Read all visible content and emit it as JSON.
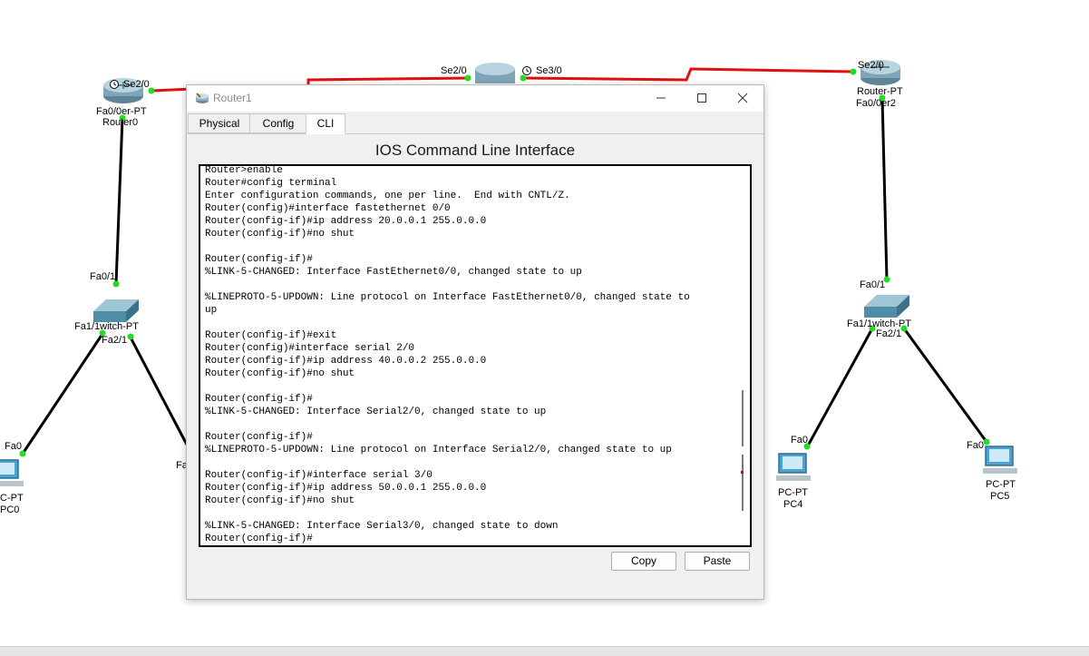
{
  "topology": {
    "links": [
      {
        "from": "Router0",
        "to": "Router1",
        "type": "serial"
      },
      {
        "from": "Router1",
        "to": "Router2",
        "type": "serial"
      },
      {
        "from": "Router0",
        "to": "Switch0",
        "type": "ethernet"
      },
      {
        "from": "Switch0",
        "to": "PC0",
        "type": "ethernet"
      },
      {
        "from": "Switch0",
        "to": "PC1",
        "type": "ethernet"
      },
      {
        "from": "Router2",
        "to": "Switch1",
        "type": "ethernet"
      },
      {
        "from": "Switch1",
        "to": "PC4",
        "type": "ethernet"
      },
      {
        "from": "Switch1",
        "to": "PC5",
        "type": "ethernet"
      }
    ],
    "labels": {
      "r0_se20": "Se2/0",
      "r0_fa00": "Fa0/0er-PT",
      "r0_name": "Router0",
      "r1_se20": "Se2/0",
      "r1_se30": "Se3/0",
      "r2_se20": "Se2/0",
      "r2_type": "Router-PT",
      "r2_fa00": "Fa0/0er2",
      "sw0_fa01": "Fa0/1",
      "sw0_name": "Fa1/1witch-PT",
      "sw0_fa21": "Fa2/1",
      "pc0_fa0": "Fa0",
      "pc0_type": "C-PT",
      "pc0_name": "PC0",
      "pc1_fa": "Fa",
      "sw1_fa01": "Fa0/1",
      "sw1_name": "Fa1/1witch-PT",
      "sw1_fa21": "Fa2/1",
      "pc4_fa0": "Fa0",
      "pc4_type": "PC-PT",
      "pc4_name": "PC4",
      "pc5_fa0": "Fa0",
      "pc5_type": "PC-PT",
      "pc5_name": "PC5"
    },
    "colors": {
      "serial_link": "#e01010",
      "ethernet_link": "#000000",
      "port_up": "#22dd22",
      "router_body": "#7fa5b8",
      "switch_body": "#4f8ea8",
      "pc_body": "#4aa3d1"
    }
  },
  "window": {
    "title": "Router1",
    "icon": "router-icon",
    "minimize_icon": "minimize-icon",
    "maximize_icon": "maximize-icon",
    "close_icon": "close-icon",
    "tabs": [
      {
        "label": "Physical",
        "active": false
      },
      {
        "label": "Config",
        "active": false
      },
      {
        "label": "CLI",
        "active": true
      }
    ],
    "heading": "IOS Command Line Interface",
    "cli_lines": [
      "Router>enable",
      "Router#config terminal",
      "Enter configuration commands, one per line.  End with CNTL/Z.",
      "Router(config)#interface fastethernet 0/0",
      "Router(config-if)#ip address 20.0.0.1 255.0.0.0",
      "Router(config-if)#no shut",
      "",
      "Router(config-if)#",
      "%LINK-5-CHANGED: Interface FastEthernet0/0, changed state to up",
      "",
      "%LINEPROTO-5-UPDOWN: Line protocol on Interface FastEthernet0/0, changed state to",
      "up",
      "",
      "Router(config-if)#exit",
      "Router(config)#interface serial 2/0",
      "Router(config-if)#ip address 40.0.0.2 255.0.0.0",
      "Router(config-if)#no shut",
      "",
      "Router(config-if)#",
      "%LINK-5-CHANGED: Interface Serial2/0, changed state to up",
      "",
      "Router(config-if)#",
      "%LINEPROTO-5-UPDOWN: Line protocol on Interface Serial2/0, changed state to up",
      "",
      "Router(config-if)#interface serial 3/0",
      "Router(config-if)#ip address 50.0.0.1 255.0.0.0",
      "Router(config-if)#no shut",
      "",
      "%LINK-5-CHANGED: Interface Serial3/0, changed state to down",
      "Router(config-if)#"
    ],
    "copy_label": "Copy",
    "paste_label": "Paste"
  }
}
